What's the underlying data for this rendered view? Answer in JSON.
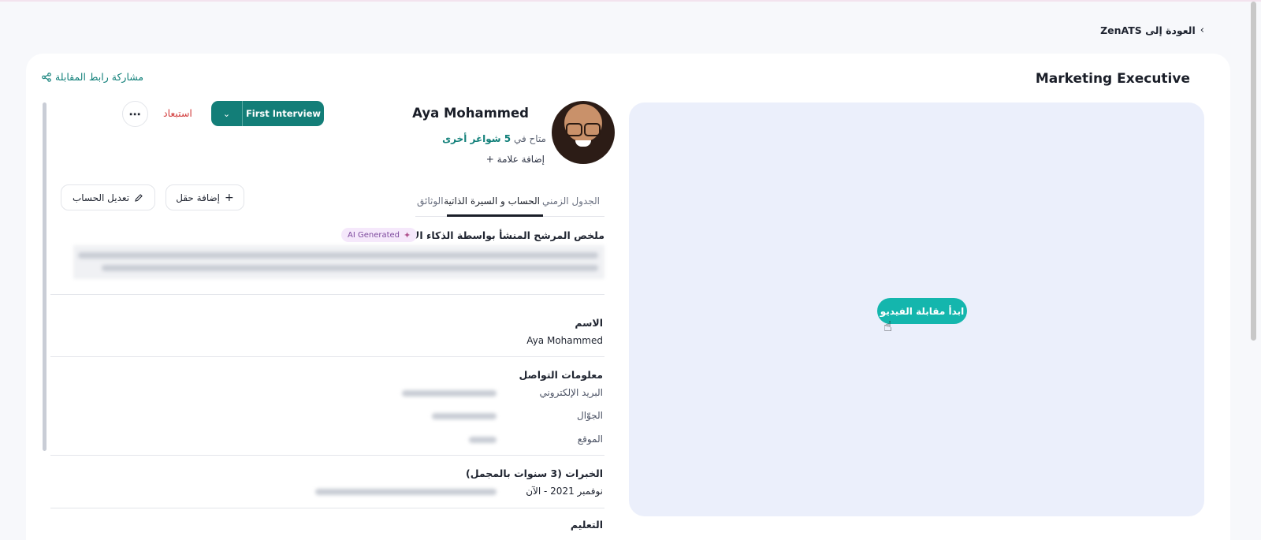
{
  "nav": {
    "back_label": "العودة إلى ZenATS"
  },
  "header": {
    "job_title": "Marketing Executive",
    "share_label": "مشاركة رابط المقابلة"
  },
  "video": {
    "start_button": "ابدأ مقابلة الفيديو"
  },
  "candidate": {
    "name": "Aya Mohammed",
    "available_prefix": "متاح في",
    "available_count": "5",
    "available_suffix": "شواغر أخرى",
    "add_tag": "إضافة علامة"
  },
  "actions": {
    "stage_label": "First Interview",
    "reject_label": "استبعاد",
    "add_field": "إضافة حقل",
    "edit_profile": "تعديل الحساب"
  },
  "tabs": [
    {
      "label": "الجدول الزمني",
      "active": false
    },
    {
      "label": "الحساب و السيرة الذاتية",
      "active": true
    },
    {
      "label": "الوثائق",
      "active": false
    }
  ],
  "profile": {
    "ai_summary_title": "ملخص المرشح المنشأ بواسطة الذكاء الاصطناعي",
    "ai_badge": "AI Generated",
    "name_label": "الاسم",
    "name_value": "Aya Mohammed",
    "contact_label": "معلومات التواصل",
    "email_label": "البريد الإلكتروني",
    "mobile_label": "الجوّال",
    "location_label": "الموقع",
    "experience_label": "الخبرات (3 سنوات بالمجمل)",
    "experience_date": "نوفمبر 2021 - الآن",
    "education_label": "التعليم"
  },
  "colors": {
    "accent": "#137e78",
    "video_button": "#14b6ad",
    "reject": "#d23d3d"
  }
}
